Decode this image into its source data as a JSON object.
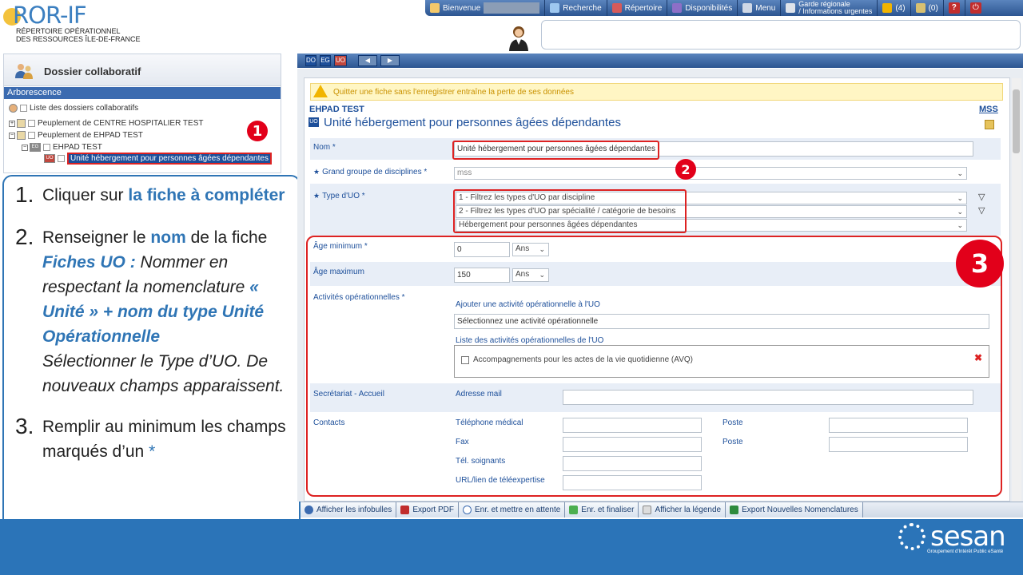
{
  "logo": {
    "main": "ROR-IF",
    "sub1": "RÉPERTOIRE OPÉRATIONNEL",
    "sub2": "DES RESSOURCES ÎLE-DE-FRANCE"
  },
  "topnav": {
    "welcome": "Bienvenue",
    "recherche": "Recherche",
    "repertoire": "Répertoire",
    "disponibilites": "Disponibilités",
    "menu": "Menu",
    "garde1": "Garde régionale",
    "garde2": "/ Informations urgentes",
    "alerts": "(4)",
    "messages": "(0)",
    "help": "?"
  },
  "left_panel": {
    "title": "Dossier collaboratif",
    "arborescence": "Arborescence",
    "tree": [
      "Liste des dossiers collaboratifs",
      "Peuplement de CENTRE HOSPITALIER TEST",
      "Peuplement de EHPAD TEST",
      "EHPAD TEST",
      "Unité hébergement pour personnes âgées dépendantes"
    ]
  },
  "badges": {
    "one": "1",
    "two": "2",
    "three": "3"
  },
  "instructions": {
    "s1_num": "1.",
    "s1_a": "Cliquer sur ",
    "s1_b": "la fiche à compléter",
    "s2_num": "2.",
    "s2_a": "Renseigner le ",
    "s2_b": "nom",
    "s2_c": " de la fiche",
    "s2_d": "Fiches UO : ",
    "s2_e": "Nommer en respectant la nomenclature ",
    "s2_f": "« Unité » + nom du type Unité Opérationnelle",
    "s2_g": "Sélectionner le Type d’UO. De nouveaux champs apparaissent.",
    "s3_num": "3.",
    "s3_a": "Remplir au minimum les champs marqués d’un ",
    "s3_b": "*"
  },
  "toolbar": {
    "do": "DO",
    "eg": "EG",
    "uo": "UO"
  },
  "form": {
    "warning": "Quitter une fiche sans l'enregistrer entraîne la perte de ses données",
    "entity": "EHPAD TEST",
    "mss": "MSS",
    "title": "Unité hébergement pour personnes âgées dépendantes",
    "uo_badge": "UO",
    "nom_label": "Nom *",
    "nom_value": "Unité hébergement pour personnes âgées dépendantes",
    "grand_groupe_label": "Grand groupe de disciplines *",
    "grand_groupe_value": "mss",
    "type_uo_label": "Type d'UO *",
    "type_uo_1": "1 - Filtrez les types d'UO par discipline",
    "type_uo_2": "2 - Filtrez les types d'UO par spécialité / catégorie de besoins",
    "type_uo_3": "Hébergement pour personnes âgées dépendantes",
    "age_min_label": "Âge minimum *",
    "age_min_value": "0",
    "age_max_label": "Âge maximum",
    "age_max_value": "150",
    "age_unit": "Ans",
    "activites_label": "Activités opérationnelles *",
    "ajouter_activite": "Ajouter une activité opérationnelle à l'UO",
    "select_activite": "Sélectionnez une activité opérationnelle",
    "liste_activites": "Liste des activités opérationnelles de l'UO",
    "activite_item": "Accompagnements pour les actes de la vie quotidienne (AVQ)",
    "secretariat_label": "Secrétariat - Accueil",
    "adresse_mail": "Adresse mail",
    "contacts_label": "Contacts",
    "tel_medical": "Téléphone médical",
    "fax": "Fax",
    "tel_soignants": "Tél. soignants",
    "url_tele": "URL/lien de téléexpertise",
    "poste": "Poste"
  },
  "bottom_tools": [
    "Afficher les infobulles",
    "Export PDF",
    "Enr. et mettre en attente",
    "Enr. et finaliser",
    "Afficher la légende",
    "Export Nouvelles Nomenclatures"
  ],
  "sesan": {
    "name": "sesan",
    "sub": "Groupement d'Intérêt Public eSanté"
  },
  "colors": {
    "brand_blue": "#2b74b8",
    "nav_blue": "#2c5591",
    "highlight_red": "#e2001a"
  }
}
